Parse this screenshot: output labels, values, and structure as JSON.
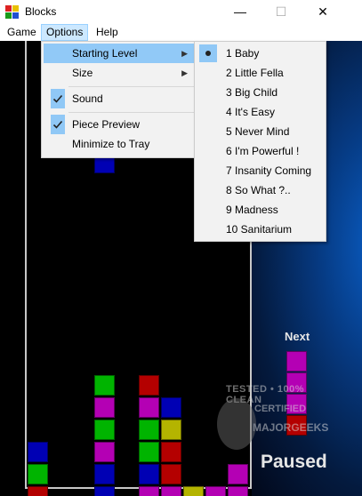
{
  "window": {
    "title": "Blocks",
    "minimize_glyph": "—",
    "maximize_glyph": "☐",
    "close_glyph": "✕"
  },
  "menubar": {
    "game": "Game",
    "options": "Options",
    "help": "Help"
  },
  "options_menu": {
    "starting_level": "Starting Level",
    "size": "Size",
    "sound": "Sound",
    "piece_preview": "Piece Preview",
    "minimize_to_tray": "Minimize to Tray",
    "submenu_arrow": "▶",
    "sound_checked": true,
    "piece_preview_checked": true
  },
  "level_menu": {
    "selected_index": 0,
    "levels": [
      "1  Baby",
      "2  Little Fella",
      "3  Big Child",
      "4  It's Easy",
      "5  Never Mind",
      "6  I'm Powerful !",
      "7  Insanity Coming",
      "8  So What ?..",
      "9  Madness",
      "10  Sanitarium"
    ]
  },
  "game": {
    "next_label": "Next",
    "status": "Paused"
  },
  "watermark": {
    "line1": "TESTED • 100% CLEAN",
    "line2": "CERTIFIED",
    "line3": "MAJORGEEKS"
  },
  "colors": {
    "green": "#00b400",
    "magenta": "#b400b4",
    "red": "#b40000",
    "blue": "#0000b4",
    "yellow": "#b4b400"
  },
  "board_blocks": [
    {
      "color": "blue",
      "col": 3,
      "row": 5
    },
    {
      "color": "green",
      "col": 3,
      "row": 15
    },
    {
      "color": "red",
      "col": 5,
      "row": 15
    },
    {
      "color": "magenta",
      "col": 3,
      "row": 16
    },
    {
      "color": "magenta",
      "col": 5,
      "row": 16
    },
    {
      "color": "blue",
      "col": 6,
      "row": 16
    },
    {
      "color": "green",
      "col": 3,
      "row": 17
    },
    {
      "color": "green",
      "col": 5,
      "row": 17
    },
    {
      "color": "yellow",
      "col": 6,
      "row": 17
    },
    {
      "color": "blue",
      "col": 0,
      "row": 18
    },
    {
      "color": "magenta",
      "col": 3,
      "row": 18
    },
    {
      "color": "green",
      "col": 5,
      "row": 18
    },
    {
      "color": "red",
      "col": 6,
      "row": 18
    },
    {
      "color": "green",
      "col": 0,
      "row": 19
    },
    {
      "color": "blue",
      "col": 3,
      "row": 19
    },
    {
      "color": "blue",
      "col": 5,
      "row": 19
    },
    {
      "color": "red",
      "col": 6,
      "row": 19
    },
    {
      "color": "magenta",
      "col": 9,
      "row": 19
    },
    {
      "color": "red",
      "col": 0,
      "row": 20
    },
    {
      "color": "blue",
      "col": 3,
      "row": 20
    },
    {
      "color": "magenta",
      "col": 5,
      "row": 20
    },
    {
      "color": "magenta",
      "col": 6,
      "row": 20
    },
    {
      "color": "yellow",
      "col": 7,
      "row": 20
    },
    {
      "color": "magenta",
      "col": 8,
      "row": 20
    },
    {
      "color": "magenta",
      "col": 9,
      "row": 20
    }
  ],
  "next_piece": [
    {
      "color": "magenta",
      "row": 0
    },
    {
      "color": "magenta",
      "row": 1
    },
    {
      "color": "magenta",
      "row": 2
    },
    {
      "color": "red",
      "row": 3
    }
  ]
}
